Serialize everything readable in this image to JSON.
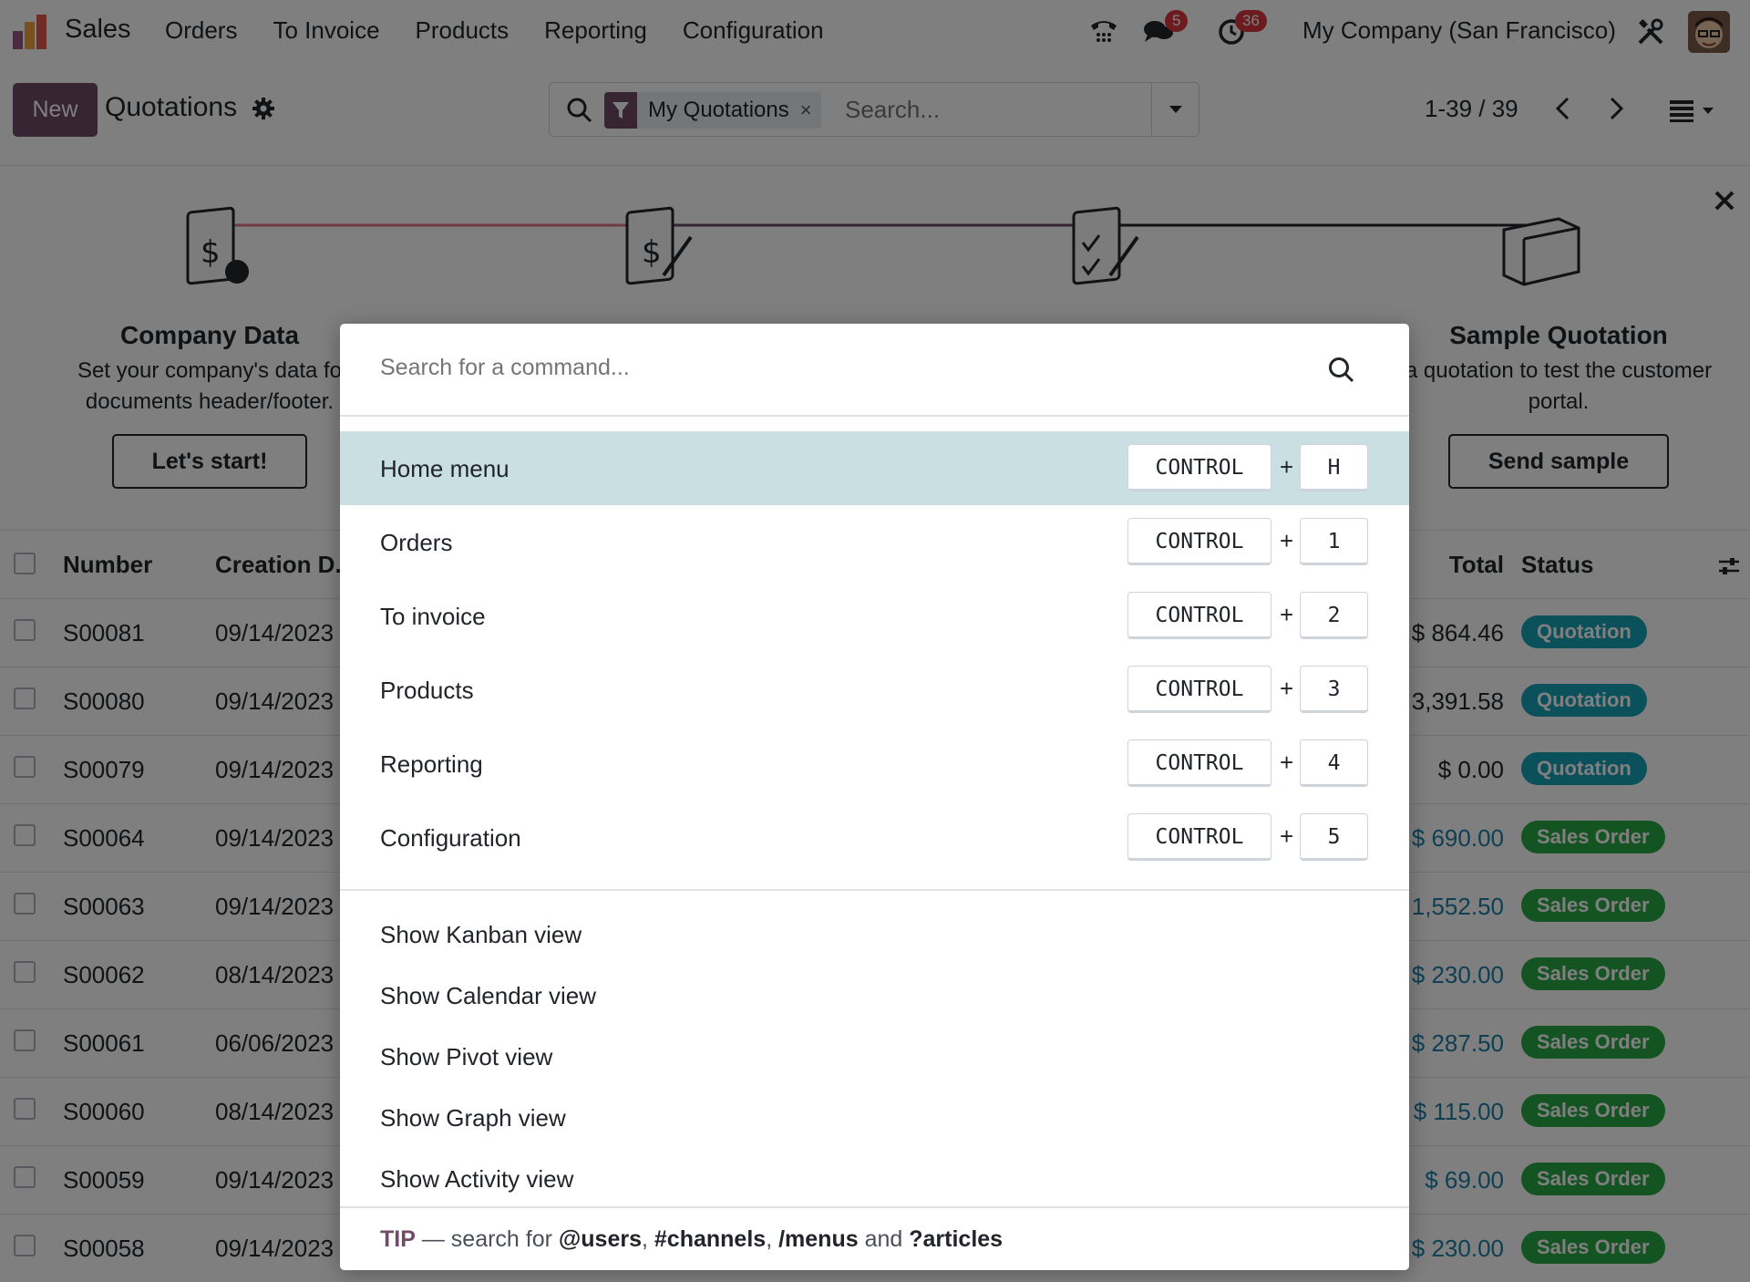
{
  "navbar": {
    "app_name": "Sales",
    "menu": [
      "Orders",
      "To Invoice",
      "Products",
      "Reporting",
      "Configuration"
    ],
    "messages_badge": "5",
    "activities_badge": "36",
    "company": "My Company (San Francisco)"
  },
  "control_panel": {
    "new_label": "New",
    "title": "Quotations",
    "facet_label": "My Quotations",
    "facet_remove": "×",
    "search_placeholder": "Search...",
    "pager": "1-39 / 39"
  },
  "banner": {
    "steps": [
      {
        "title": "Company Data",
        "desc_line1": "Set your company's data fo",
        "desc_line2": "documents header/footer.",
        "button": "Let's start!"
      },
      {
        "title": "Sample Quotation",
        "desc_line1": "a quotation to test the customer",
        "desc_line2": "portal.",
        "button": "Send sample"
      }
    ]
  },
  "table": {
    "headers": {
      "number": "Number",
      "creation_date": "Creation D...",
      "total": "Total",
      "status": "Status"
    },
    "rows": [
      {
        "number": "S00081",
        "date": "09/14/2023",
        "total": "$ 864.46",
        "status": "Quotation"
      },
      {
        "number": "S00080",
        "date": "09/14/2023",
        "total": "3,391.58",
        "status": "Quotation"
      },
      {
        "number": "S00079",
        "date": "09/14/2023",
        "total": "$ 0.00",
        "status": "Quotation"
      },
      {
        "number": "S00064",
        "date": "09/14/2023",
        "total": "$ 690.00",
        "status": "Sales Order"
      },
      {
        "number": "S00063",
        "date": "09/14/2023",
        "total": "1,552.50",
        "status": "Sales Order"
      },
      {
        "number": "S00062",
        "date": "08/14/2023",
        "total": "$ 230.00",
        "status": "Sales Order"
      },
      {
        "number": "S00061",
        "date": "06/06/2023",
        "total": "$ 287.50",
        "status": "Sales Order"
      },
      {
        "number": "S00060",
        "date": "08/14/2023",
        "total": "$ 115.00",
        "status": "Sales Order"
      },
      {
        "number": "S00059",
        "date": "09/14/2023",
        "total": "$ 69.00",
        "status": "Sales Order"
      },
      {
        "number": "S00058",
        "date": "09/14/2023",
        "total": "$ 230.00",
        "status": "Sales Order"
      }
    ]
  },
  "palette": {
    "search_placeholder": "Search for a command...",
    "commands": [
      {
        "label": "Home menu",
        "modifier": "CONTROL",
        "key": "H"
      },
      {
        "label": "Orders",
        "modifier": "CONTROL",
        "key": "1"
      },
      {
        "label": "To invoice",
        "modifier": "CONTROL",
        "key": "2"
      },
      {
        "label": "Products",
        "modifier": "CONTROL",
        "key": "3"
      },
      {
        "label": "Reporting",
        "modifier": "CONTROL",
        "key": "4"
      },
      {
        "label": "Configuration",
        "modifier": "CONTROL",
        "key": "5"
      }
    ],
    "plus": "+",
    "view_commands": [
      "Show Kanban view",
      "Show Calendar view",
      "Show Pivot view",
      "Show Graph view",
      "Show Activity view"
    ],
    "tip": {
      "head": "TIP",
      "text1": " — search for ",
      "users": "@users",
      "sep1": ", ",
      "channels": "#channels",
      "sep2": ", ",
      "menus": "/menus",
      "and": " and ",
      "articles": "?articles"
    }
  },
  "colors": {
    "brand": "#714b67",
    "quotation_badge": "#17a2b8",
    "sales_order_badge": "#28a745",
    "active_command": "#c9dfe1",
    "notification_badge": "#d9363e"
  }
}
